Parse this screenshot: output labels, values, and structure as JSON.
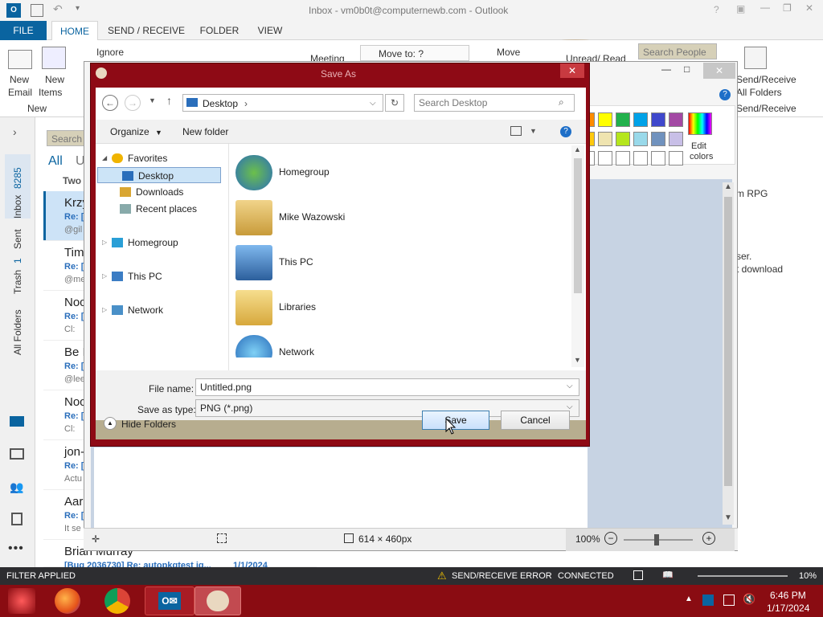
{
  "outlook": {
    "window_title": "Inbox - vm0b0t@computernewb.com - Outlook",
    "tabs": [
      "FILE",
      "HOME",
      "SEND / RECEIVE",
      "FOLDER",
      "VIEW"
    ],
    "ribbon": {
      "new_email_1": "New",
      "new_email_2": "Email",
      "new_items_1": "New",
      "new_items_2": "Items",
      "group_new": "New",
      "ignore": "Ignore",
      "meeting": "Meeting",
      "move_to": "Move to: ?",
      "move": "Move",
      "unread_read": "Unread/ Read",
      "search_people": "Search People",
      "send_receive_1": "Send/Receive",
      "send_receive_2": "All Folders",
      "group_send_receive": "Send/Receive"
    },
    "nav_rail": {
      "inbox": "Inbox",
      "inbox_count": "8285",
      "sent": "Sent",
      "trash": "Trash",
      "trash_count": "1",
      "all_folders": "All Folders"
    },
    "list": {
      "search_placeholder": "Search",
      "filter_all": "All",
      "filter_unread": "U",
      "group_header": "Two",
      "items": [
        {
          "sender": "Krzy",
          "preview": "Re: [",
          "snippet": "@gil"
        },
        {
          "sender": "Tim",
          "preview": "Re: [",
          "snippet": "@me"
        },
        {
          "sender": "Noc",
          "preview": "Re: [",
          "snippet": "Cl:"
        },
        {
          "sender": "Be I",
          "preview": "Re: [",
          "snippet": "@lee"
        },
        {
          "sender": "Noc",
          "preview": "Re: [",
          "snippet": "Cl:"
        },
        {
          "sender": "jon-",
          "preview": "Re: [",
          "snippet": "Actu"
        },
        {
          "sender": "Aar",
          "preview": "Re: [",
          "snippet": "It se"
        },
        {
          "sender": "Brian Murray",
          "preview": "[Bug 2036730] Re: autopkgtest ig...",
          "snippet": "",
          "date": "1/1/2024"
        }
      ]
    },
    "reading_pane": {
      "line1": "m RPG",
      "line2": "ser.",
      "line3": "t download"
    },
    "status": {
      "filter": "FILTER APPLIED",
      "error": "SEND/RECEIVE ERROR",
      "connected": "CONNECTED",
      "zoom": "10%"
    }
  },
  "paint": {
    "edit_colors_1": "Edit",
    "edit_colors_2": "colors",
    "palette": [
      "#ff8c00",
      "#ffff00",
      "#22b14c",
      "#00a2e8",
      "#3f48cc",
      "#a349a4",
      "#ffc90e",
      "#efe4b0",
      "#b5e61d",
      "#99d9ea",
      "#7092be",
      "#c8bfe7",
      "#ffffff",
      "#ffffff",
      "#ffffff",
      "#ffffff",
      "#ffffff",
      "#ffffff"
    ],
    "status": {
      "dimensions": "614 × 460px",
      "zoom": "100%"
    }
  },
  "dialog": {
    "title": "Save As",
    "location": "Desktop",
    "search_placeholder": "Search Desktop",
    "organize": "Organize",
    "new_folder": "New folder",
    "tree": [
      {
        "label": "Favorites",
        "icon": "star-icon",
        "level": 0
      },
      {
        "label": "Desktop",
        "icon": "desktop-icon",
        "level": 1,
        "selected": true
      },
      {
        "label": "Downloads",
        "icon": "downloads-icon",
        "level": 1
      },
      {
        "label": "Recent places",
        "icon": "recent-places-icon",
        "level": 1
      },
      {
        "label": "Homegroup",
        "icon": "homegroup-icon",
        "level": 0
      },
      {
        "label": "This PC",
        "icon": "computer-icon",
        "level": 0
      },
      {
        "label": "Network",
        "icon": "network-icon",
        "level": 0
      }
    ],
    "files": [
      {
        "label": "Homegroup",
        "icon": "homegroup-icon"
      },
      {
        "label": "Mike Wazowski",
        "icon": "user-folder-icon"
      },
      {
        "label": "This PC",
        "icon": "computer-icon"
      },
      {
        "label": "Libraries",
        "icon": "libraries-icon"
      },
      {
        "label": "Network",
        "icon": "network-icon"
      }
    ],
    "file_name_label": "File name:",
    "file_name_value": "Untitled.png",
    "save_type_label": "Save as type:",
    "save_type_value": "PNG (*.png)",
    "hide_folders": "Hide Folders",
    "save": "Save",
    "cancel": "Cancel"
  },
  "taskbar": {
    "time": "6:46 PM",
    "date": "1/17/2024"
  }
}
